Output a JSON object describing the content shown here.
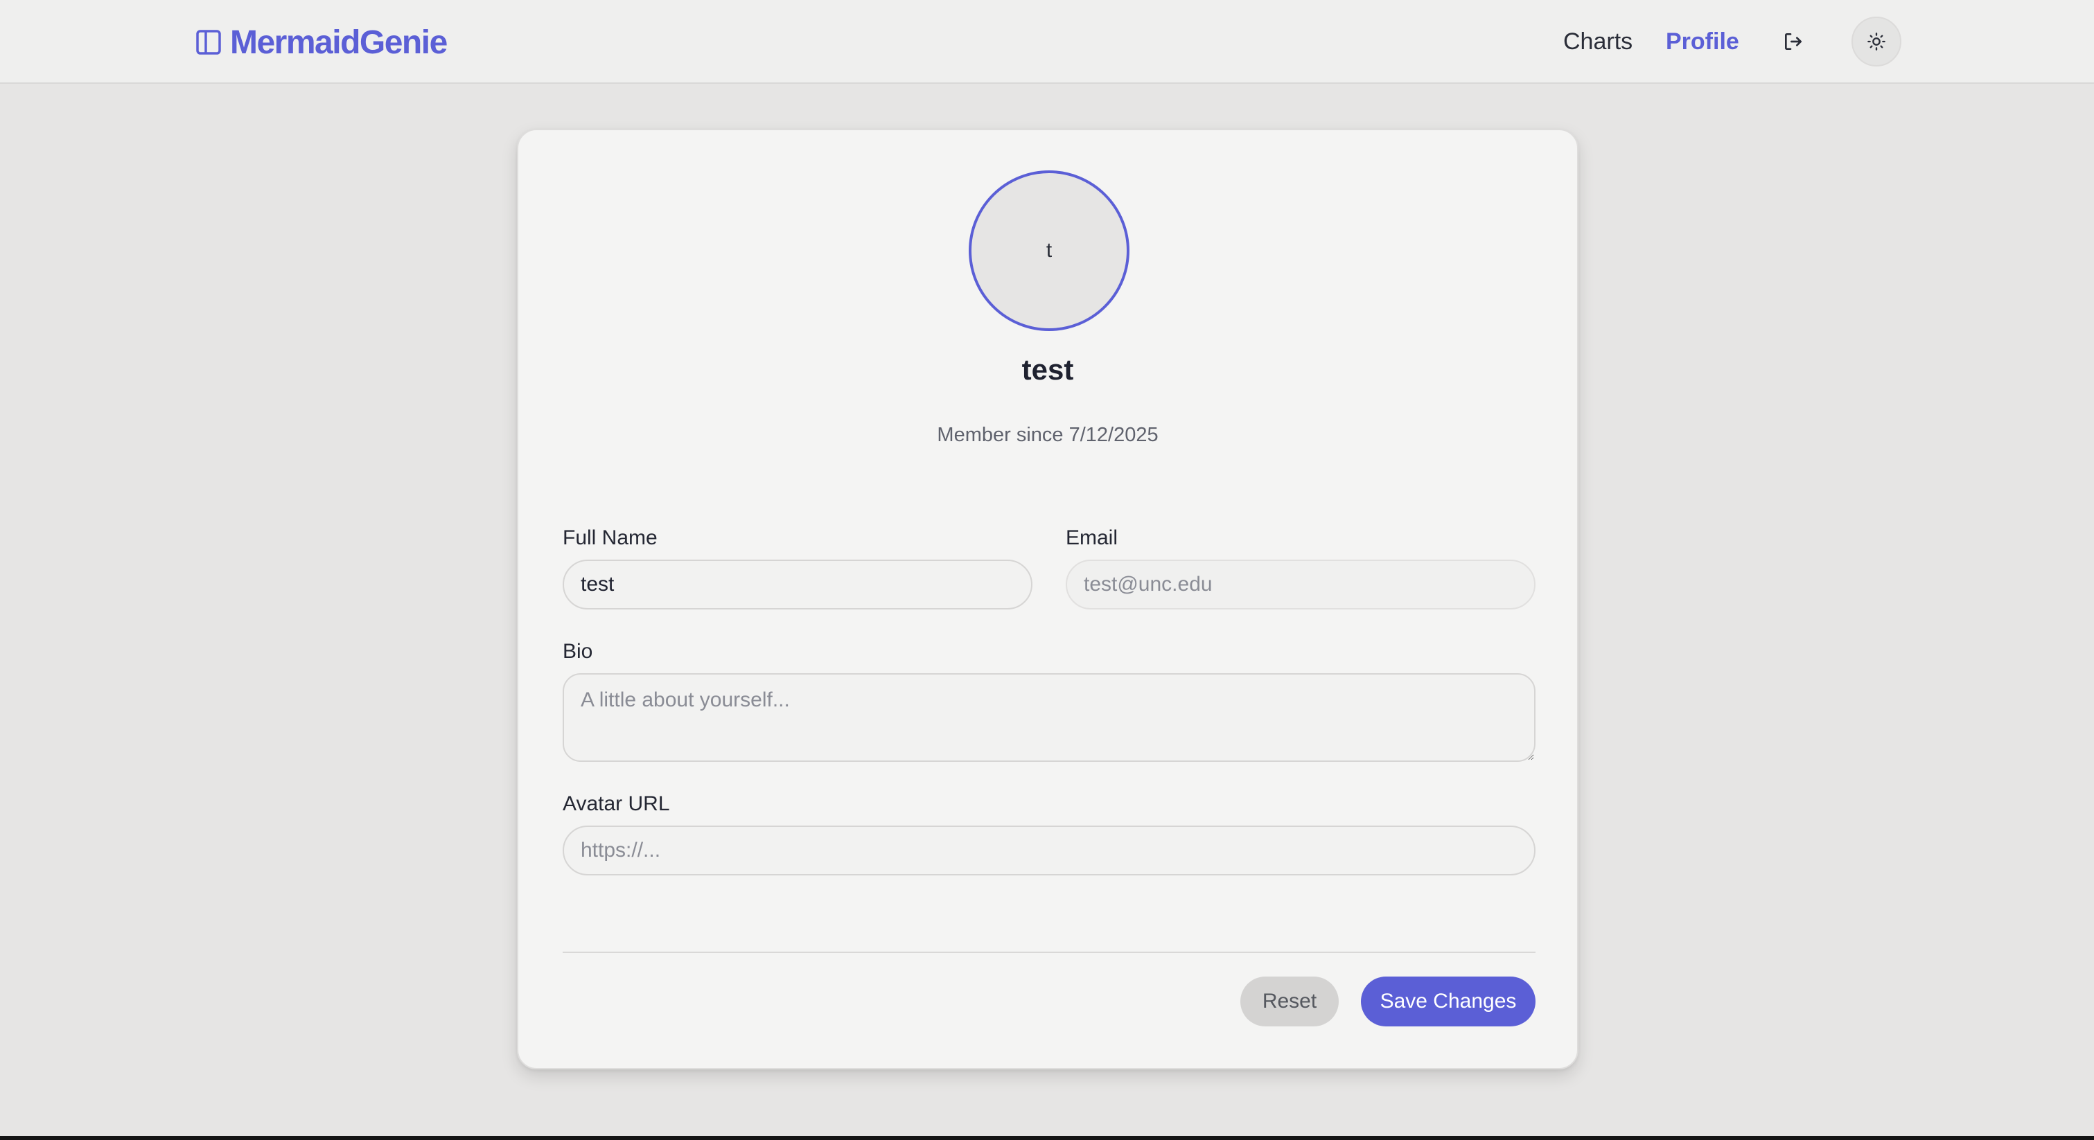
{
  "header": {
    "brand": "MermaidGenie",
    "brand_icon": "sidebar-panel-icon",
    "nav": {
      "charts": "Charts",
      "profile": "Profile"
    },
    "logout_icon": "logout-icon",
    "theme_icon": "sun-icon"
  },
  "profile": {
    "avatar_initial": "t",
    "username": "test",
    "member_since": "Member since 7/12/2025"
  },
  "form": {
    "full_name": {
      "label": "Full Name",
      "value": "test",
      "placeholder": ""
    },
    "email": {
      "label": "Email",
      "value": "",
      "placeholder": "test@unc.edu"
    },
    "bio": {
      "label": "Bio",
      "value": "",
      "placeholder": "A little about yourself..."
    },
    "avatar_url": {
      "label": "Avatar URL",
      "value": "",
      "placeholder": "https://..."
    }
  },
  "actions": {
    "reset": "Reset",
    "save": "Save Changes"
  },
  "colors": {
    "accent": "#5b5fd6",
    "background": "#e6e5e4",
    "card": "#f4f4f3"
  }
}
